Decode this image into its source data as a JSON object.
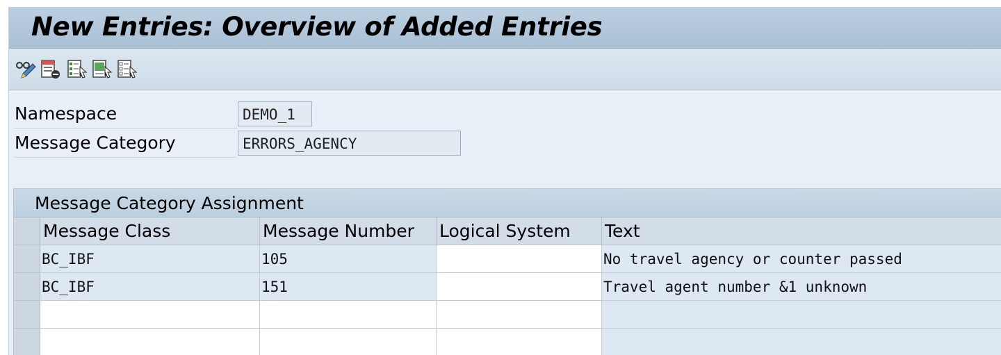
{
  "window": {
    "title": "New Entries: Overview of Added Entries"
  },
  "toolbar": {
    "buttons": [
      {
        "name": "display-change-icon"
      },
      {
        "name": "delete-icon"
      },
      {
        "name": "select-all-icon"
      },
      {
        "name": "select-block-icon"
      },
      {
        "name": "deselect-all-icon"
      }
    ]
  },
  "header": {
    "namespace_label": "Namespace",
    "namespace_value": "DEMO_1",
    "category_label": "Message Category",
    "category_value": "ERRORS_AGENCY"
  },
  "table": {
    "title": "Message Category Assignment",
    "columns": [
      "Message Class",
      "Message Number",
      "Logical System",
      "Text"
    ],
    "rows": [
      [
        "BC_IBF",
        "105",
        "",
        "No travel agency or counter passed"
      ],
      [
        "BC_IBF",
        "151",
        "",
        "Travel agent number &1 unknown"
      ],
      [
        "",
        "",
        "",
        ""
      ],
      [
        "",
        "",
        "",
        ""
      ]
    ]
  },
  "colors": {
    "title_bar": "#a9c0d6",
    "background": "#e8eff6",
    "readonly_cell": "#dde8f2"
  }
}
